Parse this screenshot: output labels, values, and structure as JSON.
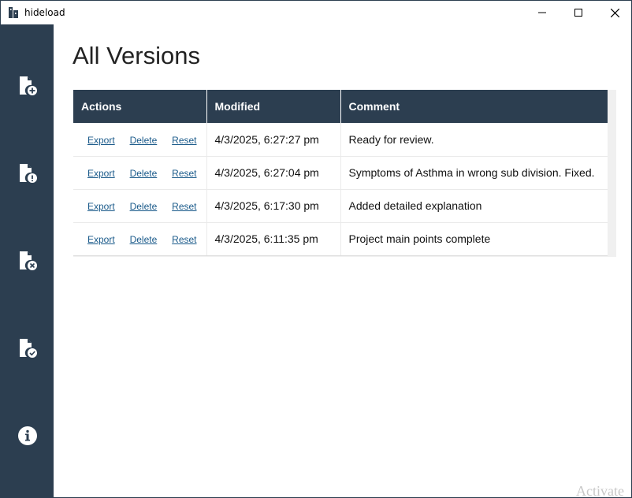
{
  "window": {
    "title": "hideload"
  },
  "sidebar": {
    "items": [
      {
        "icon": "file-add-icon"
      },
      {
        "icon": "file-alert-icon"
      },
      {
        "icon": "file-remove-icon"
      },
      {
        "icon": "file-check-icon"
      },
      {
        "icon": "info-icon"
      }
    ]
  },
  "page": {
    "title": "All Versions"
  },
  "table": {
    "headers": [
      "Actions",
      "Modified",
      "Comment"
    ],
    "action_labels": {
      "export": "Export",
      "delete": "Delete",
      "reset": "Reset"
    },
    "rows": [
      {
        "modified": "4/3/2025, 6:27:27 pm",
        "comment": "Ready for review."
      },
      {
        "modified": "4/3/2025, 6:27:04 pm",
        "comment": "Symptoms of Asthma in wrong sub division. Fixed."
      },
      {
        "modified": "4/3/2025, 6:17:30 pm",
        "comment": "Added detailed explanation"
      },
      {
        "modified": "4/3/2025, 6:11:35 pm",
        "comment": "Project main points complete"
      }
    ]
  },
  "watermark": "Activate",
  "colors": {
    "sidebar": "#2c3e50",
    "header": "#2c3e50",
    "link": "#1a5a8a"
  }
}
